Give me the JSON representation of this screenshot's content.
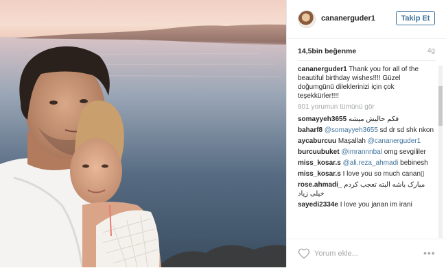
{
  "post": {
    "username": "cananerguder1",
    "follow_label": "Takip Et",
    "likes": "14,5bin beğenme",
    "age": "4g",
    "view_all_comments": "801 yorumun tümünü gör"
  },
  "caption": {
    "username": "cananerguder1",
    "text": " Thank you for all of the beautiful birthday wishes!!!! Güzel doğumgünü dileklerinizi için çok teşekkürler!!!!"
  },
  "comments": [
    {
      "username": "somayyeh3655",
      "mention": "",
      "text": " فکم حالیش میشه"
    },
    {
      "username": "baharf8",
      "mention": "@somayyeh3655",
      "text": " sd dr sd shk nkon"
    },
    {
      "username": "aycaburcuu",
      "mention": "@cananerguder1",
      "text": " Maşallah "
    },
    {
      "username": "burcuubuket",
      "mention": "@imrannnbal",
      "text": " omg sevgililer"
    },
    {
      "username": "miss_kosar.s",
      "mention": "@ali.reza_ahmadi",
      "text": " bebinesh"
    },
    {
      "username": "miss_kosar.s",
      "mention": "",
      "text": " I love you so much canan▯"
    },
    {
      "username": "rose.ahmadi_",
      "mention": "",
      "text": " مبارک باشه البته تعجب کردم خیلی زیاد"
    },
    {
      "username": "sayedi2334e",
      "mention": "",
      "text": " I love you janan im irani"
    }
  ],
  "comment_input": {
    "placeholder": "Yorum ekle..."
  },
  "more_label": "•••",
  "icons": {
    "like": "heart-icon",
    "options": "more-options-icon"
  },
  "colors": {
    "link": "#3f729b",
    "muted": "#a5a7aa",
    "text": "#262626"
  }
}
